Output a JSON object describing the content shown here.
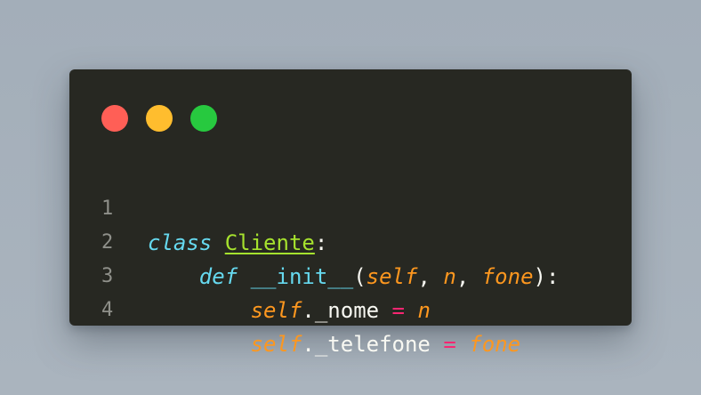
{
  "window": {
    "controls": [
      {
        "name": "close",
        "color": "#ff5f56"
      },
      {
        "name": "minimize",
        "color": "#ffbd2e"
      },
      {
        "name": "maximize",
        "color": "#27c93f"
      }
    ]
  },
  "code": {
    "lines": [
      {
        "number": "1",
        "tokens": {
          "t1": "class",
          "t2": " ",
          "t3": "Cliente",
          "t4": ":"
        }
      },
      {
        "number": "2",
        "tokens": {
          "indent": "    ",
          "t1": "def",
          "t2": " ",
          "t3": "__init__",
          "t4": "(",
          "t5": "self",
          "t6": ", ",
          "t7": "n",
          "t8": ", ",
          "t9": "fone",
          "t10": "):"
        }
      },
      {
        "number": "3",
        "tokens": {
          "indent": "        ",
          "t1": "self",
          "t2": "._nome ",
          "t3": "=",
          "t4": " ",
          "t5": "n"
        }
      },
      {
        "number": "4",
        "tokens": {
          "indent": "        ",
          "t1": "self",
          "t2": "._telefone ",
          "t3": "=",
          "t4": " ",
          "t5": "fone"
        }
      }
    ]
  }
}
